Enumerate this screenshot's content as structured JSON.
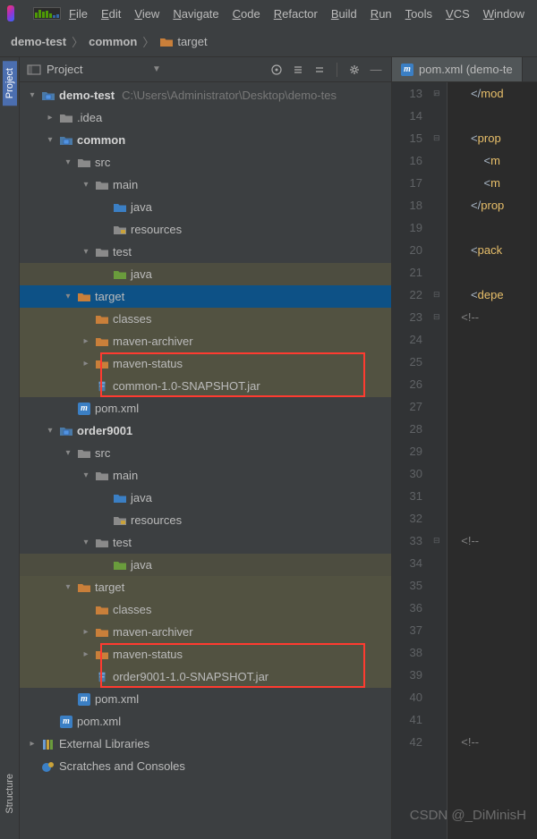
{
  "menus": [
    "File",
    "Edit",
    "View",
    "Navigate",
    "Code",
    "Refactor",
    "Build",
    "Run",
    "Tools",
    "VCS",
    "Window"
  ],
  "breadcrumb": [
    {
      "label": "demo-test",
      "bold": true
    },
    {
      "label": "common",
      "bold": true
    },
    {
      "label": "target",
      "icon": true
    }
  ],
  "project_header": {
    "title": "Project"
  },
  "tree": [
    {
      "indent": 0,
      "arrow": "down",
      "icon": "module",
      "label": "demo-test",
      "bold": true,
      "path": "C:\\Users\\Administrator\\Desktop\\demo-tes"
    },
    {
      "indent": 1,
      "arrow": "right",
      "icon": "folder-grey",
      "label": ".idea"
    },
    {
      "indent": 1,
      "arrow": "down",
      "icon": "module",
      "label": "common",
      "bold": true
    },
    {
      "indent": 2,
      "arrow": "down",
      "icon": "folder-grey",
      "label": "src"
    },
    {
      "indent": 3,
      "arrow": "down",
      "icon": "folder-grey",
      "label": "main"
    },
    {
      "indent": 4,
      "arrow": "",
      "icon": "folder-blue",
      "label": "java"
    },
    {
      "indent": 4,
      "arrow": "",
      "icon": "folder-res",
      "label": "resources"
    },
    {
      "indent": 3,
      "arrow": "down",
      "icon": "folder-grey",
      "label": "test"
    },
    {
      "indent": 4,
      "arrow": "",
      "icon": "folder-green",
      "label": "java",
      "shade": 1
    },
    {
      "indent": 2,
      "arrow": "down",
      "icon": "folder-orange",
      "label": "target",
      "selected": true
    },
    {
      "indent": 3,
      "arrow": "",
      "icon": "folder-orange",
      "label": "classes",
      "shade": 2
    },
    {
      "indent": 3,
      "arrow": "right",
      "icon": "folder-orange",
      "label": "maven-archiver",
      "shade": 2
    },
    {
      "indent": 3,
      "arrow": "right",
      "icon": "folder-orange",
      "label": "maven-status",
      "shade": 2
    },
    {
      "indent": 3,
      "arrow": "",
      "icon": "jar",
      "label": "common-1.0-SNAPSHOT.jar",
      "shade": 2
    },
    {
      "indent": 2,
      "arrow": "",
      "icon": "maven",
      "label": "pom.xml"
    },
    {
      "indent": 1,
      "arrow": "down",
      "icon": "module",
      "label": "order9001",
      "bold": true
    },
    {
      "indent": 2,
      "arrow": "down",
      "icon": "folder-grey",
      "label": "src"
    },
    {
      "indent": 3,
      "arrow": "down",
      "icon": "folder-grey",
      "label": "main"
    },
    {
      "indent": 4,
      "arrow": "",
      "icon": "folder-blue",
      "label": "java"
    },
    {
      "indent": 4,
      "arrow": "",
      "icon": "folder-res",
      "label": "resources"
    },
    {
      "indent": 3,
      "arrow": "down",
      "icon": "folder-grey",
      "label": "test"
    },
    {
      "indent": 4,
      "arrow": "",
      "icon": "folder-green",
      "label": "java",
      "shade": 1
    },
    {
      "indent": 2,
      "arrow": "down",
      "icon": "folder-orange",
      "label": "target",
      "shade": 2
    },
    {
      "indent": 3,
      "arrow": "",
      "icon": "folder-orange",
      "label": "classes",
      "shade": 2
    },
    {
      "indent": 3,
      "arrow": "right",
      "icon": "folder-orange",
      "label": "maven-archiver",
      "shade": 2
    },
    {
      "indent": 3,
      "arrow": "right",
      "icon": "folder-orange",
      "label": "maven-status",
      "shade": 2
    },
    {
      "indent": 3,
      "arrow": "",
      "icon": "jar",
      "label": "order9001-1.0-SNAPSHOT.jar",
      "shade": 2
    },
    {
      "indent": 2,
      "arrow": "",
      "icon": "maven",
      "label": "pom.xml"
    },
    {
      "indent": 1,
      "arrow": "",
      "icon": "maven",
      "label": "pom.xml"
    },
    {
      "indent": 0,
      "arrow": "right",
      "icon": "lib",
      "label": "External Libraries",
      "noArrowPad": true
    },
    {
      "indent": 0,
      "arrow": "",
      "icon": "scratch",
      "label": "Scratches and Consoles",
      "noArrowPad": true
    }
  ],
  "editor": {
    "tab_label": "pom.xml (demo-te",
    "lines": [
      {
        "n": 13,
        "html": "     &lt;/<span class='tag'>mod</span>"
      },
      {
        "n": 14,
        "html": ""
      },
      {
        "n": 15,
        "html": "     &lt;<span class='tag'>prop</span>"
      },
      {
        "n": 16,
        "html": "         &lt;<span class='tag'>m</span>"
      },
      {
        "n": 17,
        "html": "         &lt;<span class='tag'>m</span>"
      },
      {
        "n": 18,
        "html": "     &lt;/<span class='tag'>prop</span>"
      },
      {
        "n": 19,
        "html": ""
      },
      {
        "n": 20,
        "html": "     &lt;<span class='tag'>pack</span>"
      },
      {
        "n": 21,
        "html": ""
      },
      {
        "n": 22,
        "html": "     &lt;<span class='tag'>depe</span>"
      },
      {
        "n": 23,
        "html": "  <span class='comment'>&lt;!--</span>"
      },
      {
        "n": 24,
        "html": ""
      },
      {
        "n": 25,
        "html": ""
      },
      {
        "n": 26,
        "html": ""
      },
      {
        "n": 27,
        "html": ""
      },
      {
        "n": 28,
        "html": ""
      },
      {
        "n": 29,
        "html": ""
      },
      {
        "n": 30,
        "html": ""
      },
      {
        "n": 31,
        "html": ""
      },
      {
        "n": 32,
        "html": ""
      },
      {
        "n": 33,
        "html": "  <span class='comment'>&lt;!--</span>"
      },
      {
        "n": 34,
        "html": ""
      },
      {
        "n": 35,
        "html": ""
      },
      {
        "n": 36,
        "html": ""
      },
      {
        "n": 37,
        "html": ""
      },
      {
        "n": 38,
        "html": ""
      },
      {
        "n": 39,
        "html": ""
      },
      {
        "n": 40,
        "html": ""
      },
      {
        "n": 41,
        "html": ""
      },
      {
        "n": 42,
        "html": "  <span class='comment'>&lt;!--</span>"
      }
    ]
  },
  "rail": {
    "project": "Project",
    "structure": "Structure"
  },
  "watermark": "CSDN @_DiMinisH"
}
